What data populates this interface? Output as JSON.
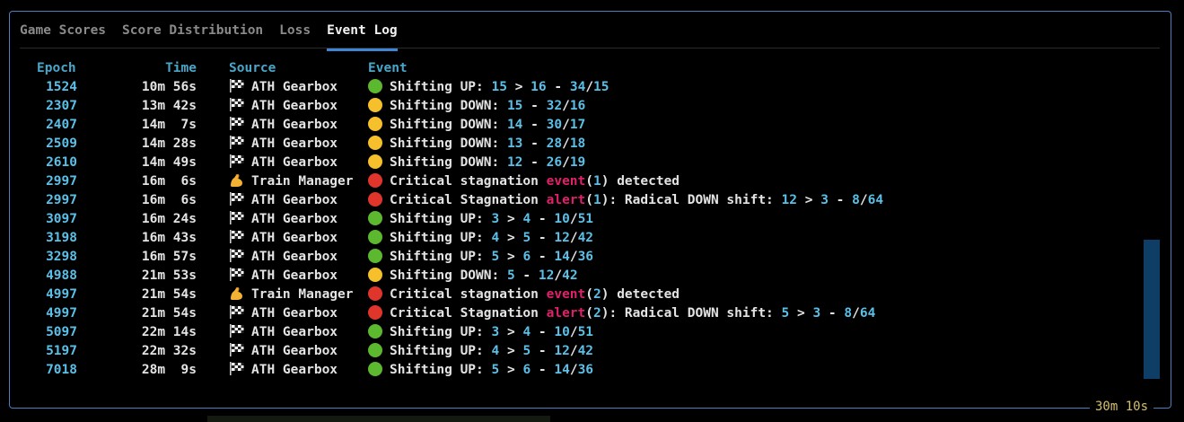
{
  "tabs": [
    {
      "label": "Game Scores",
      "active": false
    },
    {
      "label": "Score Distribution",
      "active": false
    },
    {
      "label": "Loss",
      "active": false
    },
    {
      "label": "Event Log",
      "active": true
    }
  ],
  "columns": {
    "epoch": "Epoch",
    "time": "Time",
    "source": "Source",
    "event": "Event"
  },
  "rows": [
    {
      "epoch": "1524",
      "time": "10m 56s",
      "source_icon": "checkered-flag-icon",
      "source": "ATH Gearbox",
      "status": "green",
      "event": [
        [
          "t",
          "Shifting UP: "
        ],
        [
          "n",
          "15"
        ],
        [
          "t",
          " > "
        ],
        [
          "n",
          "16"
        ],
        [
          "t",
          " - "
        ],
        [
          "n",
          "34"
        ],
        [
          "t",
          "/"
        ],
        [
          "n",
          "15"
        ]
      ]
    },
    {
      "epoch": "2307",
      "time": "13m 42s",
      "source_icon": "checkered-flag-icon",
      "source": "ATH Gearbox",
      "status": "yellow",
      "event": [
        [
          "t",
          "Shifting DOWN: "
        ],
        [
          "n",
          "15"
        ],
        [
          "t",
          " - "
        ],
        [
          "n",
          "32"
        ],
        [
          "t",
          "/"
        ],
        [
          "n",
          "16"
        ]
      ]
    },
    {
      "epoch": "2407",
      "time": "14m  7s",
      "source_icon": "checkered-flag-icon",
      "source": "ATH Gearbox",
      "status": "yellow",
      "event": [
        [
          "t",
          "Shifting DOWN: "
        ],
        [
          "n",
          "14"
        ],
        [
          "t",
          " - "
        ],
        [
          "n",
          "30"
        ],
        [
          "t",
          "/"
        ],
        [
          "n",
          "17"
        ]
      ]
    },
    {
      "epoch": "2509",
      "time": "14m 28s",
      "source_icon": "checkered-flag-icon",
      "source": "ATH Gearbox",
      "status": "yellow",
      "event": [
        [
          "t",
          "Shifting DOWN: "
        ],
        [
          "n",
          "13"
        ],
        [
          "t",
          " - "
        ],
        [
          "n",
          "28"
        ],
        [
          "t",
          "/"
        ],
        [
          "n",
          "18"
        ]
      ]
    },
    {
      "epoch": "2610",
      "time": "14m 49s",
      "source_icon": "checkered-flag-icon",
      "source": "ATH Gearbox",
      "status": "yellow",
      "event": [
        [
          "t",
          "Shifting DOWN: "
        ],
        [
          "n",
          "12"
        ],
        [
          "t",
          " - "
        ],
        [
          "n",
          "26"
        ],
        [
          "t",
          "/"
        ],
        [
          "n",
          "19"
        ]
      ]
    },
    {
      "epoch": "2997",
      "time": "16m  6s",
      "source_icon": "flexed-bicep-icon",
      "source": "Train Manager",
      "status": "red",
      "event": [
        [
          "t",
          "Critical stagnation "
        ],
        [
          "k",
          "event"
        ],
        [
          "t",
          "("
        ],
        [
          "n",
          "1"
        ],
        [
          "t",
          ") detected"
        ]
      ]
    },
    {
      "epoch": "2997",
      "time": "16m  6s",
      "source_icon": "checkered-flag-icon",
      "source": "ATH Gearbox",
      "status": "red",
      "event": [
        [
          "t",
          "Critical Stagnation "
        ],
        [
          "k",
          "alert"
        ],
        [
          "t",
          "("
        ],
        [
          "n",
          "1"
        ],
        [
          "t",
          "): Radical DOWN shift: "
        ],
        [
          "n",
          "12"
        ],
        [
          "t",
          " > "
        ],
        [
          "n",
          "3"
        ],
        [
          "t",
          " - "
        ],
        [
          "n",
          "8"
        ],
        [
          "t",
          "/"
        ],
        [
          "n",
          "64"
        ]
      ]
    },
    {
      "epoch": "3097",
      "time": "16m 24s",
      "source_icon": "checkered-flag-icon",
      "source": "ATH Gearbox",
      "status": "green",
      "event": [
        [
          "t",
          "Shifting UP: "
        ],
        [
          "n",
          "3"
        ],
        [
          "t",
          " > "
        ],
        [
          "n",
          "4"
        ],
        [
          "t",
          " - "
        ],
        [
          "n",
          "10"
        ],
        [
          "t",
          "/"
        ],
        [
          "n",
          "51"
        ]
      ]
    },
    {
      "epoch": "3198",
      "time": "16m 43s",
      "source_icon": "checkered-flag-icon",
      "source": "ATH Gearbox",
      "status": "green",
      "event": [
        [
          "t",
          "Shifting UP: "
        ],
        [
          "n",
          "4"
        ],
        [
          "t",
          " > "
        ],
        [
          "n",
          "5"
        ],
        [
          "t",
          " - "
        ],
        [
          "n",
          "12"
        ],
        [
          "t",
          "/"
        ],
        [
          "n",
          "42"
        ]
      ]
    },
    {
      "epoch": "3298",
      "time": "16m 57s",
      "source_icon": "checkered-flag-icon",
      "source": "ATH Gearbox",
      "status": "green",
      "event": [
        [
          "t",
          "Shifting UP: "
        ],
        [
          "n",
          "5"
        ],
        [
          "t",
          " > "
        ],
        [
          "n",
          "6"
        ],
        [
          "t",
          " - "
        ],
        [
          "n",
          "14"
        ],
        [
          "t",
          "/"
        ],
        [
          "n",
          "36"
        ]
      ]
    },
    {
      "epoch": "4988",
      "time": "21m 53s",
      "source_icon": "checkered-flag-icon",
      "source": "ATH Gearbox",
      "status": "yellow",
      "event": [
        [
          "t",
          "Shifting DOWN: "
        ],
        [
          "n",
          "5"
        ],
        [
          "t",
          " - "
        ],
        [
          "n",
          "12"
        ],
        [
          "t",
          "/"
        ],
        [
          "n",
          "42"
        ]
      ]
    },
    {
      "epoch": "4997",
      "time": "21m 54s",
      "source_icon": "flexed-bicep-icon",
      "source": "Train Manager",
      "status": "red",
      "event": [
        [
          "t",
          "Critical stagnation "
        ],
        [
          "k",
          "event"
        ],
        [
          "t",
          "("
        ],
        [
          "n",
          "2"
        ],
        [
          "t",
          ") detected"
        ]
      ]
    },
    {
      "epoch": "4997",
      "time": "21m 54s",
      "source_icon": "checkered-flag-icon",
      "source": "ATH Gearbox",
      "status": "red",
      "event": [
        [
          "t",
          "Critical Stagnation "
        ],
        [
          "k",
          "alert"
        ],
        [
          "t",
          "("
        ],
        [
          "n",
          "2"
        ],
        [
          "t",
          "): Radical DOWN shift: "
        ],
        [
          "n",
          "5"
        ],
        [
          "t",
          " > "
        ],
        [
          "n",
          "3"
        ],
        [
          "t",
          " - "
        ],
        [
          "n",
          "8"
        ],
        [
          "t",
          "/"
        ],
        [
          "n",
          "64"
        ]
      ]
    },
    {
      "epoch": "5097",
      "time": "22m 14s",
      "source_icon": "checkered-flag-icon",
      "source": "ATH Gearbox",
      "status": "green",
      "event": [
        [
          "t",
          "Shifting UP: "
        ],
        [
          "n",
          "3"
        ],
        [
          "t",
          " > "
        ],
        [
          "n",
          "4"
        ],
        [
          "t",
          " - "
        ],
        [
          "n",
          "10"
        ],
        [
          "t",
          "/"
        ],
        [
          "n",
          "51"
        ]
      ]
    },
    {
      "epoch": "5197",
      "time": "22m 32s",
      "source_icon": "checkered-flag-icon",
      "source": "ATH Gearbox",
      "status": "green",
      "event": [
        [
          "t",
          "Shifting UP: "
        ],
        [
          "n",
          "4"
        ],
        [
          "t",
          " > "
        ],
        [
          "n",
          "5"
        ],
        [
          "t",
          " - "
        ],
        [
          "n",
          "12"
        ],
        [
          "t",
          "/"
        ],
        [
          "n",
          "42"
        ]
      ]
    },
    {
      "epoch": "7018",
      "time": "28m  9s",
      "source_icon": "checkered-flag-icon",
      "source": "ATH Gearbox",
      "status": "green",
      "event": [
        [
          "t",
          "Shifting UP: "
        ],
        [
          "n",
          "5"
        ],
        [
          "t",
          " > "
        ],
        [
          "n",
          "6"
        ],
        [
          "t",
          " - "
        ],
        [
          "n",
          "14"
        ],
        [
          "t",
          "/"
        ],
        [
          "n",
          "36"
        ]
      ]
    }
  ],
  "status_bar": {
    "elapsed": "30m 10s"
  },
  "colors": {
    "border": "#4a7fc1",
    "number": "#5bc0e8",
    "keyword": "#e0206a",
    "header": "#4aa6c9",
    "status_green": "#5cb82f",
    "status_yellow": "#f5c02b",
    "status_red": "#e0352b",
    "scrollbar": "#0e3d66",
    "elapsed": "#d4c06a"
  }
}
